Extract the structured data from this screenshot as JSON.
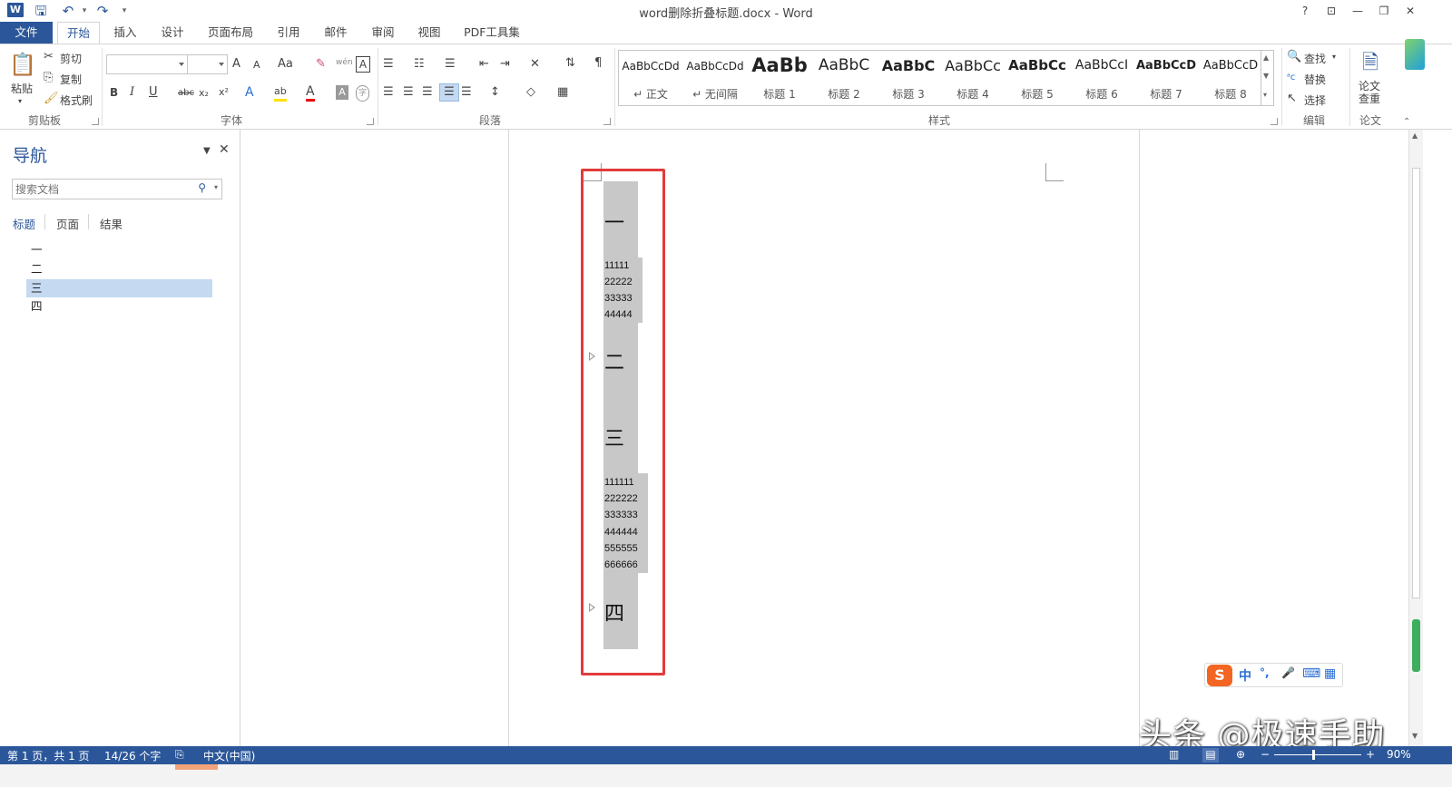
{
  "titlebar": {
    "title": "word删除折叠标题.docx - Word",
    "logo": "W",
    "controls": {
      "help": "?",
      "ribbon_opts": "⊡",
      "minimize": "—",
      "restore": "❐",
      "close": "✕"
    }
  },
  "tabs": {
    "file": "文件",
    "items": [
      "开始",
      "插入",
      "设计",
      "页面布局",
      "引用",
      "邮件",
      "审阅",
      "视图",
      "PDF工具集"
    ]
  },
  "ribbon": {
    "clipboard": {
      "paste": "粘贴",
      "cut": "剪切",
      "copy": "复制",
      "format_painter": "格式刷",
      "label": "剪贴板"
    },
    "font": {
      "label": "字体",
      "bold": "B",
      "italic": "I",
      "underline": "U",
      "strike": "abc",
      "sub": "x₂",
      "sup": "x²",
      "grow": "A",
      "shrink": "A",
      "case": "Aa",
      "clear": "✎",
      "pinyin": "wén",
      "border": "A",
      "effects": "A",
      "highlight": "ab",
      "color": "A",
      "shading": "A",
      "enclose": "字"
    },
    "paragraph": {
      "label": "段落"
    },
    "styles": {
      "label": "样式",
      "items": [
        {
          "sample": "AaBbCcDd",
          "name": "↵ 正文"
        },
        {
          "sample": "AaBbCcDd",
          "name": "↵ 无间隔"
        },
        {
          "sample": "AaBb",
          "name": "标题 1"
        },
        {
          "sample": "AaBbC",
          "name": "标题 2"
        },
        {
          "sample": "AaBbC",
          "name": "标题 3"
        },
        {
          "sample": "AaBbCc",
          "name": "标题 4"
        },
        {
          "sample": "AaBbCc",
          "name": "标题 5"
        },
        {
          "sample": "AaBbCcI",
          "name": "标题 6"
        },
        {
          "sample": "AaBbCcD",
          "name": "标题 7"
        },
        {
          "sample": "AaBbCcD",
          "name": "标题 8"
        }
      ]
    },
    "editing": {
      "label": "编辑",
      "find": "查找",
      "replace": "替换",
      "select": "选择"
    },
    "paper": {
      "label": "论文",
      "check": "论文\n查重"
    }
  },
  "nav": {
    "title": "导航",
    "search_placeholder": "搜索文档",
    "tabs": [
      "标题",
      "页面",
      "结果"
    ],
    "items": [
      "一",
      "二",
      "三",
      "四"
    ]
  },
  "document": {
    "h1": "一",
    "block1": [
      "11111",
      "22222",
      "33333",
      "44444"
    ],
    "h2": "二",
    "h3": "三",
    "block3": [
      "111111",
      "222222",
      "333333",
      "444444",
      "555555",
      "666666"
    ],
    "h4": "四"
  },
  "ime": {
    "logo": "S",
    "mode": "中",
    "punct": "°,",
    "mic": "🎤",
    "keyboard": "⌨",
    "apps": "▦"
  },
  "watermark": "头条 @极速手助",
  "statusbar": {
    "page": "第 1 页，共 1 页",
    "words": "14/26 个字",
    "lang": "中文(中国)",
    "zoom": "90%"
  },
  "colors": {
    "accent": "#2b579a",
    "highlight": "#c8c8c8",
    "redbox": "#e23b3b",
    "nav_selected": "#c5d9f1"
  }
}
